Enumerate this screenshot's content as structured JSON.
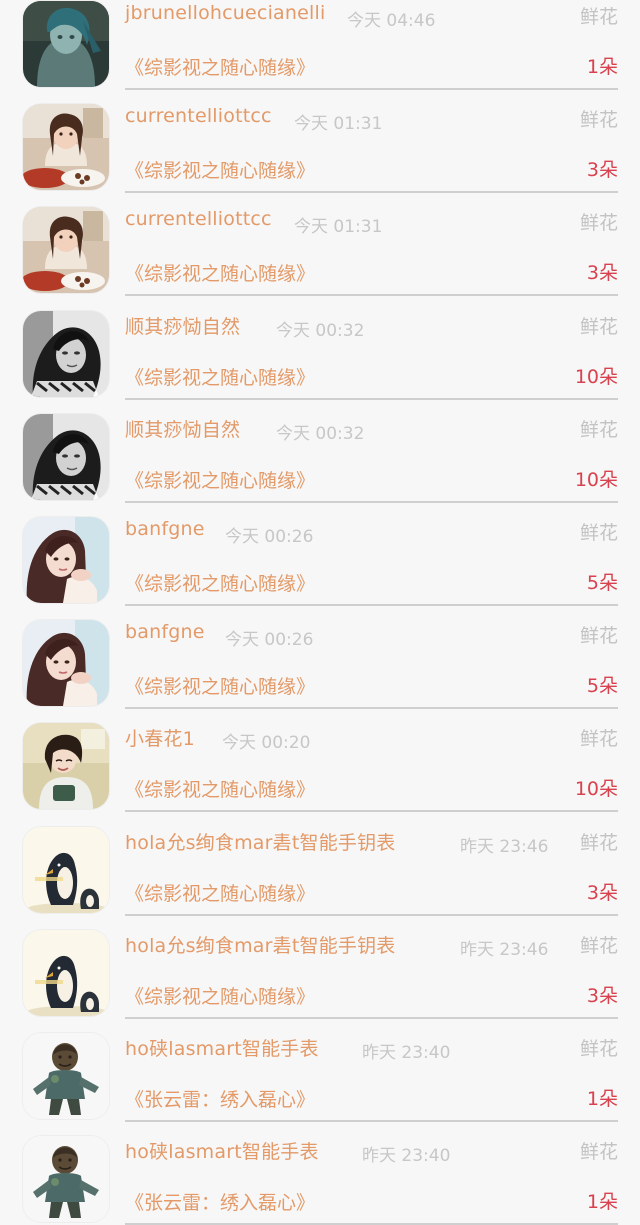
{
  "records": [
    {
      "username": "jbrunellohcuecianelli",
      "time": "今天 04:46",
      "gift": "鲜花",
      "book": "《综影视之随心随缘》",
      "count": "1朵",
      "avatar": "avatar-a"
    },
    {
      "username": "currentelliottcc",
      "time": "今天 01:31",
      "gift": "鲜花",
      "book": "《综影视之随心随缘》",
      "count": "3朵",
      "avatar": "avatar-b"
    },
    {
      "username": "currentelliottcc",
      "time": "今天 01:31",
      "gift": "鲜花",
      "book": "《综影视之随心随缘》",
      "count": "3朵",
      "avatar": "avatar-b"
    },
    {
      "username": "顺其痧恸自然",
      "time": "今天 00:32",
      "gift": "鲜花",
      "book": "《综影视之随心随缘》",
      "count": "10朵",
      "avatar": "avatar-c"
    },
    {
      "username": "顺其痧恸自然",
      "time": "今天 00:32",
      "gift": "鲜花",
      "book": "《综影视之随心随缘》",
      "count": "10朵",
      "avatar": "avatar-c"
    },
    {
      "username": "banfgne",
      "time": "今天 00:26",
      "gift": "鲜花",
      "book": "《综影视之随心随缘》",
      "count": "5朵",
      "avatar": "avatar-d"
    },
    {
      "username": "banfgne",
      "time": "今天 00:26",
      "gift": "鲜花",
      "book": "《综影视之随心随缘》",
      "count": "5朵",
      "avatar": "avatar-d"
    },
    {
      "username": "小春花1",
      "time": "今天 00:20",
      "gift": "鲜花",
      "book": "《综影视之随心随缘》",
      "count": "10朵",
      "avatar": "avatar-e"
    },
    {
      "username": "hola允s绚食mar砉t智能手钥表",
      "time": "昨天 23:46",
      "gift": "鲜花",
      "book": "《综影视之随心随缘》",
      "count": "3朵",
      "avatar": "avatar-f"
    },
    {
      "username": "hola允s绚食mar砉t智能手钥表",
      "time": "昨天 23:46",
      "gift": "鲜花",
      "book": "《综影视之随心随缘》",
      "count": "3朵",
      "avatar": "avatar-f"
    },
    {
      "username": "ho硖lasmart智能手表",
      "time": "昨天 23:40",
      "gift": "鲜花",
      "book": "《张云雷：绣入磊心》",
      "count": "1朵",
      "avatar": "avatar-g"
    },
    {
      "username": "ho硖lasmart智能手表",
      "time": "昨天 23:40",
      "gift": "鲜花",
      "book": "《张云雷：绣入磊心》",
      "count": "1朵",
      "avatar": "avatar-g"
    }
  ],
  "colors": {
    "name": "#e39a68",
    "time": "#c7c7c7",
    "gift": "#c3c3c3",
    "count": "#d8414d",
    "background": "#f7f7f7"
  }
}
